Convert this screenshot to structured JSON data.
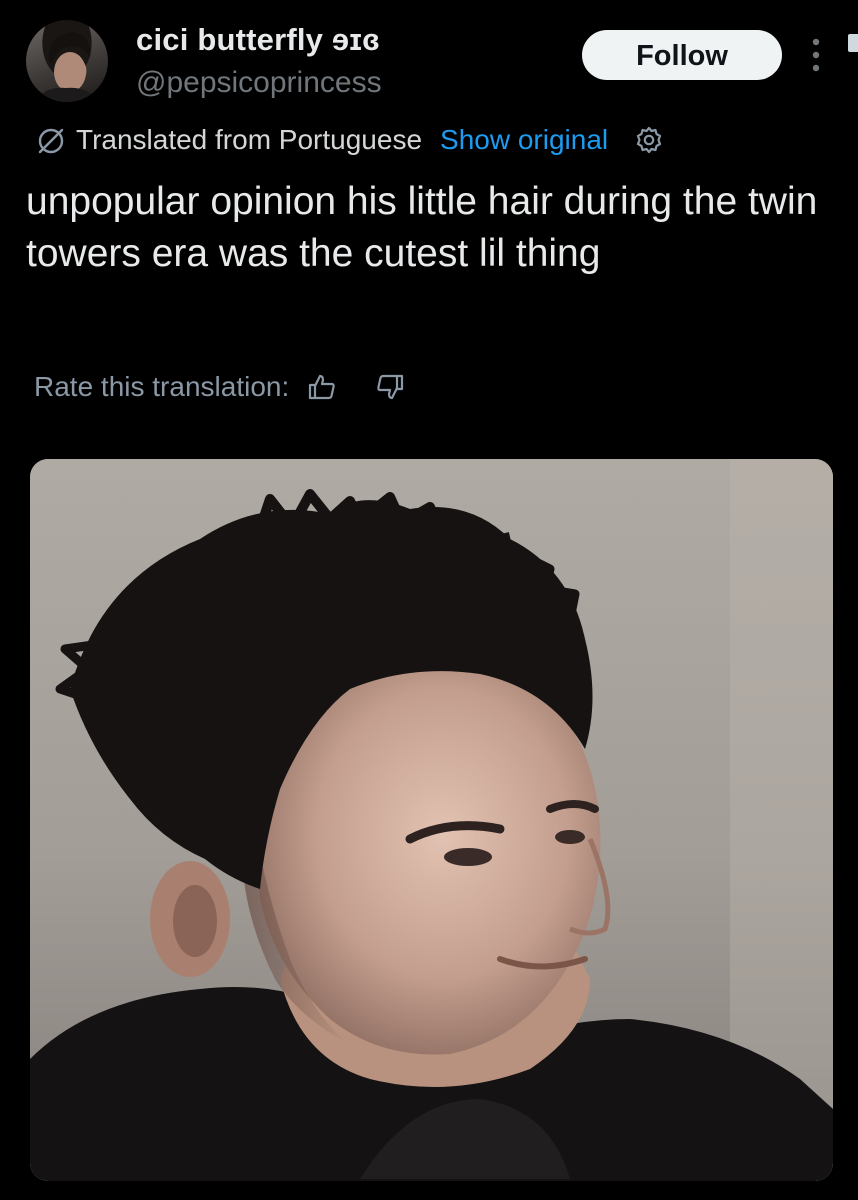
{
  "user": {
    "display_name": "cici butterfly ɘɪɞ",
    "handle": "@pepsicoprincess"
  },
  "follow_label": "Follow",
  "translation": {
    "label": "Translated from Portuguese",
    "show_original": "Show original"
  },
  "tweet": {
    "text": "unpopular opinion his little hair during the twin towers era was the cutest lil thing"
  },
  "rate": {
    "label": "Rate this translation:"
  },
  "icons": {
    "more": "more-vertical-icon",
    "translate": "translate-slash-icon",
    "settings": "gear-icon",
    "rate_up": "thumbs-up-icon",
    "rate_down": "thumbs-down-icon"
  },
  "colors": {
    "background": "#000000",
    "text": "#e7e9ea",
    "secondary_text": "#71767b",
    "link": "#1d9bf0",
    "follow_button_bg": "#eff3f4",
    "follow_button_text": "#0f1419"
  }
}
